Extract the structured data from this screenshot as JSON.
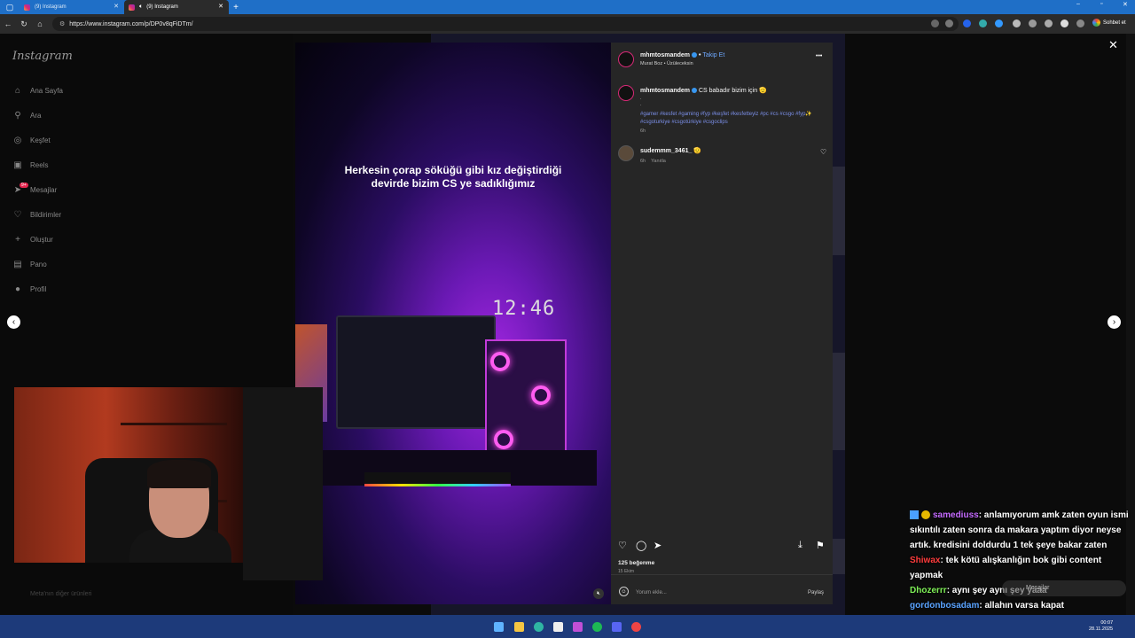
{
  "browser": {
    "tabs": [
      {
        "label": "(9) Instagram"
      },
      {
        "label": "(9) Instagram"
      }
    ],
    "url": "https://www.instagram.com/p/DP0v8qFiDTm/",
    "sohbet": "Sohbet et"
  },
  "sidebar": {
    "logo": "Instagram",
    "items": [
      {
        "label": "Ana Sayfa"
      },
      {
        "label": "Ara"
      },
      {
        "label": "Keşfet"
      },
      {
        "label": "Reels"
      },
      {
        "label": "Mesajlar",
        "badge": "9+"
      },
      {
        "label": "Bildirimler"
      },
      {
        "label": "Oluştur"
      },
      {
        "label": "Pano"
      },
      {
        "label": "Profil"
      }
    ],
    "meta": "Meta'nın diğer ürünleri"
  },
  "video": {
    "caption_line1": "Herkesin çorap söküğü gibi kız değiştirdiği",
    "caption_line2": "devirde bizim CS ye sadıklığımız",
    "clock": "12:46"
  },
  "post": {
    "author": "mhmtosmandem",
    "follow": "Takip Et",
    "audio": "Murat Boz • Üzüleceksin",
    "caption_text": "CS babadır bizim için 🫡",
    "caption_dots": ".",
    "hashtags": "#gamer #kesfet #gaming #fyp #keşfet #kesfetteyiz #pc #cs #csgo #fyp✨ #csgoturkiye #csgotürkiye #csgoclips",
    "caption_time": "6h",
    "comment_user": "sudemmm_3461_ 🫡",
    "comment_time": "6h",
    "reply": "Yanıtla",
    "likes": "125 beğenme",
    "date": "15 Ekim",
    "comment_placeholder": "Yorum ekle...",
    "share": "Paylaş"
  },
  "chat": [
    {
      "user": "samediuss",
      "text": ": anlamıyorum amk zaten oyun ismi sıkıntılı zaten sonra da makara yaptım diyor neyse artık. kredisini doldurdu 1 tek şeye bakar zaten"
    },
    {
      "user": "Shiwax",
      "text": ": tek kötü alışkanlığın bok gibi content yapmak"
    },
    {
      "user": "Dhozerrr",
      "text": ": aynı şey aynı şey yaaa"
    },
    {
      "user": "gordonbosadam",
      "text": ": allahın varsa kapat"
    }
  ],
  "overlay": {
    "messages": "Mesajlar"
  },
  "taskbar": {
    "time": "00:07",
    "date": "28.11.2025"
  }
}
